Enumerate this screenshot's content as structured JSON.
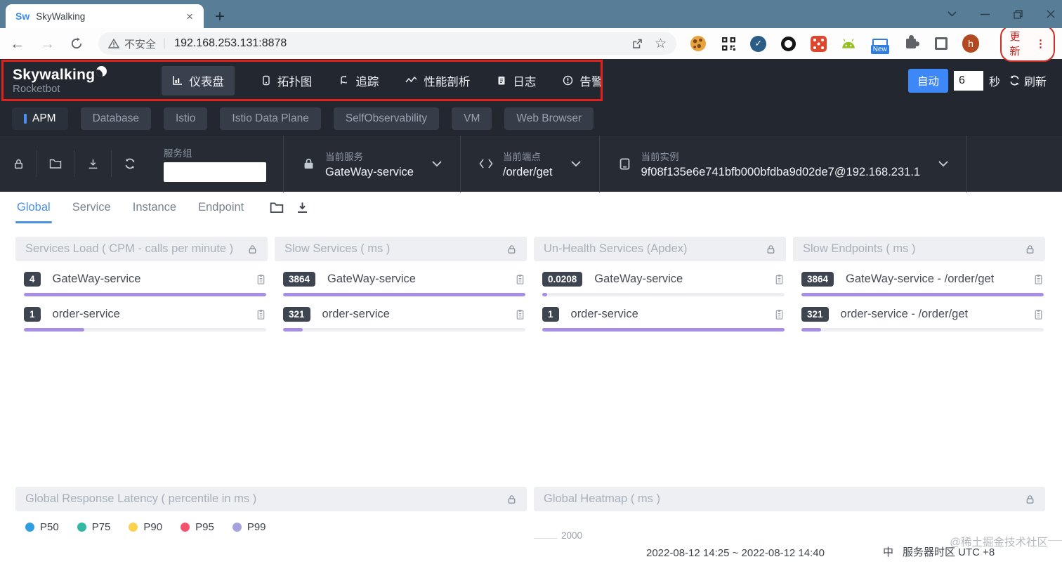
{
  "browser": {
    "favicon_text": "Sw",
    "tab_title": "SkyWalking",
    "security_label": "不安全",
    "url": "192.168.253.131:8878",
    "new_badge_label": "New",
    "avatar_letter": "h",
    "update_label": "更新"
  },
  "header": {
    "logo_title": "Skywalking",
    "logo_subtitle": "Rocketbot",
    "nav": [
      {
        "label": "仪表盘"
      },
      {
        "label": "拓扑图"
      },
      {
        "label": "追踪"
      },
      {
        "label": "性能剖析"
      },
      {
        "label": "日志"
      },
      {
        "label": "告警"
      }
    ],
    "auto_button": "自动",
    "refresh_seconds": "6",
    "seconds_label": "秒",
    "refresh_label": "刷新"
  },
  "dashboard_nav": [
    {
      "label": "APM"
    },
    {
      "label": "Database"
    },
    {
      "label": "Istio"
    },
    {
      "label": "Istio Data Plane"
    },
    {
      "label": "SelfObservability"
    },
    {
      "label": "VM"
    },
    {
      "label": "Web Browser"
    }
  ],
  "selectors": {
    "service_group_label": "服务组",
    "service_group_value": "",
    "current_service_label": "当前服务",
    "current_service_value": "GateWay-service",
    "current_endpoint_label": "当前端点",
    "current_endpoint_value": "/order/get",
    "current_instance_label": "当前实例",
    "current_instance_value": "9f08f135e6e741bfb000bfdba9d02de7@192.168.231.1"
  },
  "view_tabs": [
    {
      "label": "Global"
    },
    {
      "label": "Service"
    },
    {
      "label": "Instance"
    },
    {
      "label": "Endpoint"
    }
  ],
  "cards": [
    {
      "title": "Services Load ( CPM - calls per minute )",
      "items": [
        {
          "value": "4",
          "name": "GateWay-service",
          "bar_pct": 100
        },
        {
          "value": "1",
          "name": "order-service",
          "bar_pct": 25
        }
      ]
    },
    {
      "title": "Slow Services ( ms )",
      "items": [
        {
          "value": "3864",
          "name": "GateWay-service",
          "bar_pct": 100
        },
        {
          "value": "321",
          "name": "order-service",
          "bar_pct": 8
        }
      ]
    },
    {
      "title": "Un-Health Services (Apdex)",
      "items": [
        {
          "value": "0.0208",
          "name": "GateWay-service",
          "bar_pct": 2
        },
        {
          "value": "1",
          "name": "order-service",
          "bar_pct": 100
        }
      ]
    },
    {
      "title": "Slow Endpoints ( ms )",
      "items": [
        {
          "value": "3864",
          "name": "GateWay-service - /order/get",
          "bar_pct": 100
        },
        {
          "value": "321",
          "name": "order-service - /order/get",
          "bar_pct": 8
        }
      ]
    }
  ],
  "charts": {
    "latency_title": "Global Response Latency ( percentile in ms )",
    "legend": [
      {
        "label": "P50",
        "color": "#2f9ee0"
      },
      {
        "label": "P75",
        "color": "#30b8a2"
      },
      {
        "label": "P90",
        "color": "#fcd24c"
      },
      {
        "label": "P95",
        "color": "#f4536e"
      },
      {
        "label": "P99",
        "color": "#a6a2e0"
      }
    ],
    "heatmap_title": "Global Heatmap ( ms )",
    "heatmap_tick": "2000"
  },
  "footer": {
    "time_range": "2022-08-12 14:25 ~ 2022-08-12 14:40",
    "lang": "中",
    "timezone": "服务器时区 UTC +8",
    "watermark": "@稀土掘金技术社区"
  }
}
